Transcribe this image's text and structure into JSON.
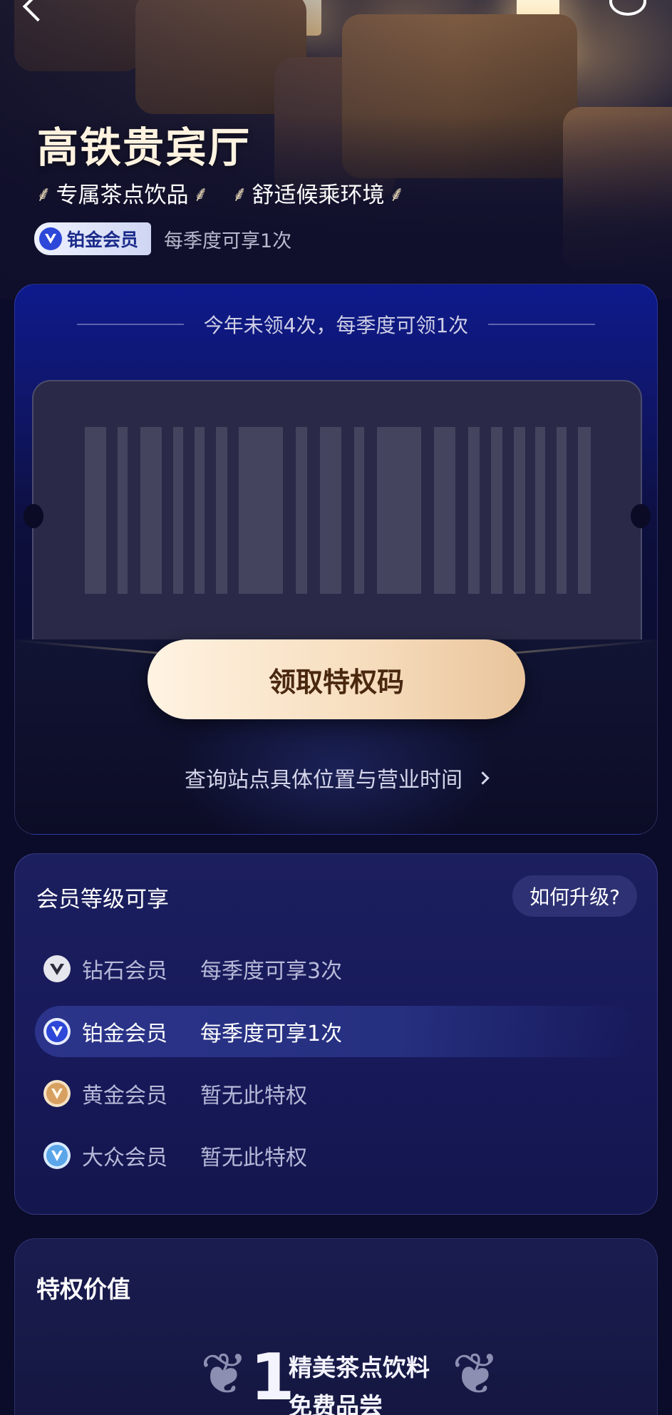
{
  "hero": {
    "title": "高铁贵宾厅",
    "tags": [
      "专属茶点饮品",
      "舒适候乘环境"
    ],
    "badge_label": "铂金会员",
    "quota": "每季度可享1次"
  },
  "privilege": {
    "remaining_text": "今年未领4次，每季度可领1次",
    "claim_button": "领取特权码",
    "query_link": "查询站点具体位置与营业时间"
  },
  "levels": {
    "title": "会员等级可享",
    "upgrade_button": "如何升级?",
    "rows": [
      {
        "name": "钻石会员",
        "quota": "每季度可享3次",
        "icon": "diamond-badge-icon",
        "color": "#e6e6ee"
      },
      {
        "name": "铂金会员",
        "quota": "每季度可享1次",
        "icon": "platinum-badge-icon",
        "color": "#2d47d8",
        "active": true
      },
      {
        "name": "黄金会员",
        "quota": "暂无此特权",
        "icon": "gold-badge-icon",
        "color": "#d8a060"
      },
      {
        "name": "大众会员",
        "quota": "暂无此特权",
        "icon": "basic-badge-icon",
        "color": "#5aa6e8"
      }
    ]
  },
  "value": {
    "title": "特权价值",
    "number": "1",
    "line1": "精美茶点饮料",
    "line2": "免费品尝"
  },
  "colors": {
    "background": "#0b0b2a",
    "accent_gold": "#f6dcbc",
    "platinum": "#2d47d8"
  }
}
